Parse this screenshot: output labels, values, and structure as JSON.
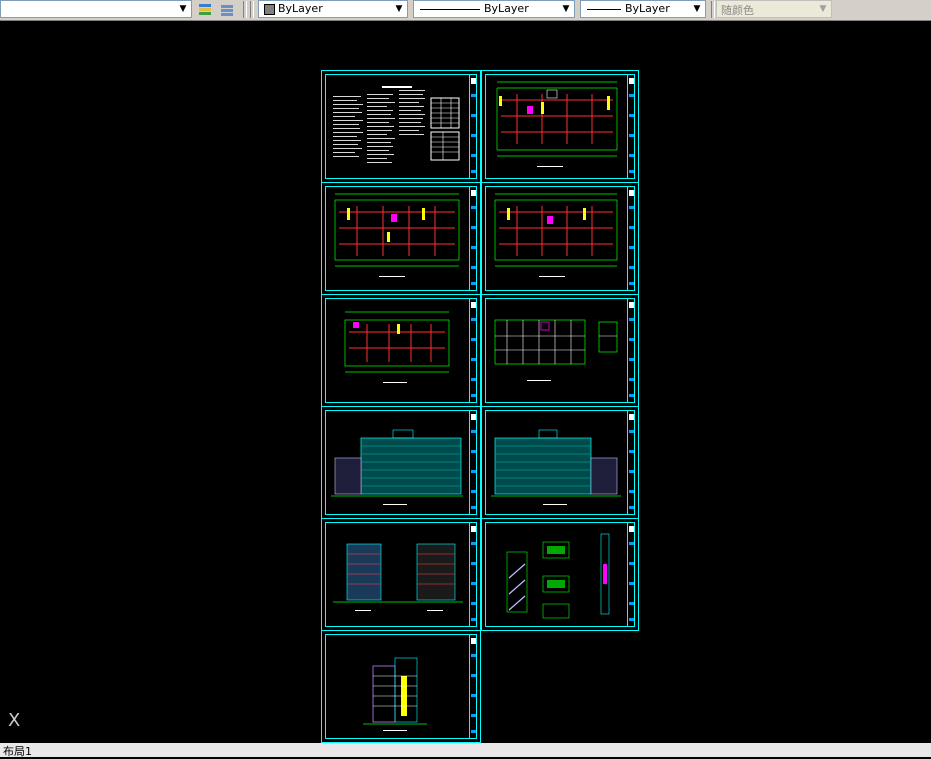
{
  "toolbar": {
    "color_combo": "ByLayer",
    "linetype_combo": "ByLayer",
    "lineweight_combo": "ByLayer",
    "plotstyle_combo": "随颜色"
  },
  "status": {
    "layout_tab": "布局1"
  },
  "ucs_label": "X",
  "icons": [
    "dropdown-arrow-icon",
    "layer-states-icon",
    "layer-previous-icon",
    "color-swatch-icon",
    "ucs-icon"
  ],
  "colors": {
    "sheet_border": "#00ffff",
    "background": "#000000",
    "toolbar": "#d4d0c8"
  }
}
